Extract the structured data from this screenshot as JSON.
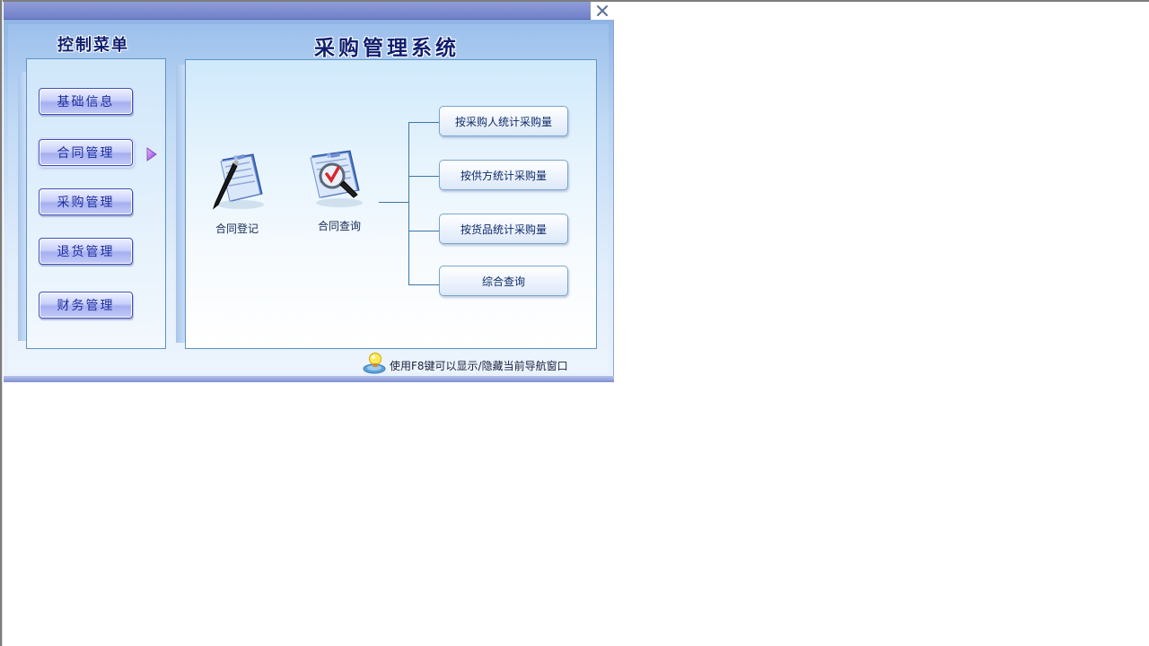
{
  "window": {
    "close_icon": "close-icon"
  },
  "sidebar": {
    "title": "控制菜单",
    "items": [
      {
        "label": "基础信息",
        "active": false
      },
      {
        "label": "合同管理",
        "active": true
      },
      {
        "label": "采购管理",
        "active": false
      },
      {
        "label": "退货管理",
        "active": false
      },
      {
        "label": "财务管理",
        "active": false
      }
    ]
  },
  "main": {
    "title": "采购管理系统",
    "features": [
      {
        "label": "合同登记",
        "icon": "contract-register-icon"
      },
      {
        "label": "合同查询",
        "icon": "contract-query-icon"
      }
    ],
    "query_options": [
      {
        "label": "按采购人统计采购量"
      },
      {
        "label": "按供方统计采购量"
      },
      {
        "label": "按货品统计采购量"
      },
      {
        "label": "综合查询"
      }
    ]
  },
  "footer": {
    "hint_icon": "lightbulb-icon",
    "hint": "使用F8键可以显示/隐藏当前导航窗口"
  },
  "colors": {
    "title_text": "#0f1e6e",
    "menu_button_text": "#1d2d9e",
    "border_blue": "#5e93c7",
    "titlebar": "#7d8ecf"
  }
}
